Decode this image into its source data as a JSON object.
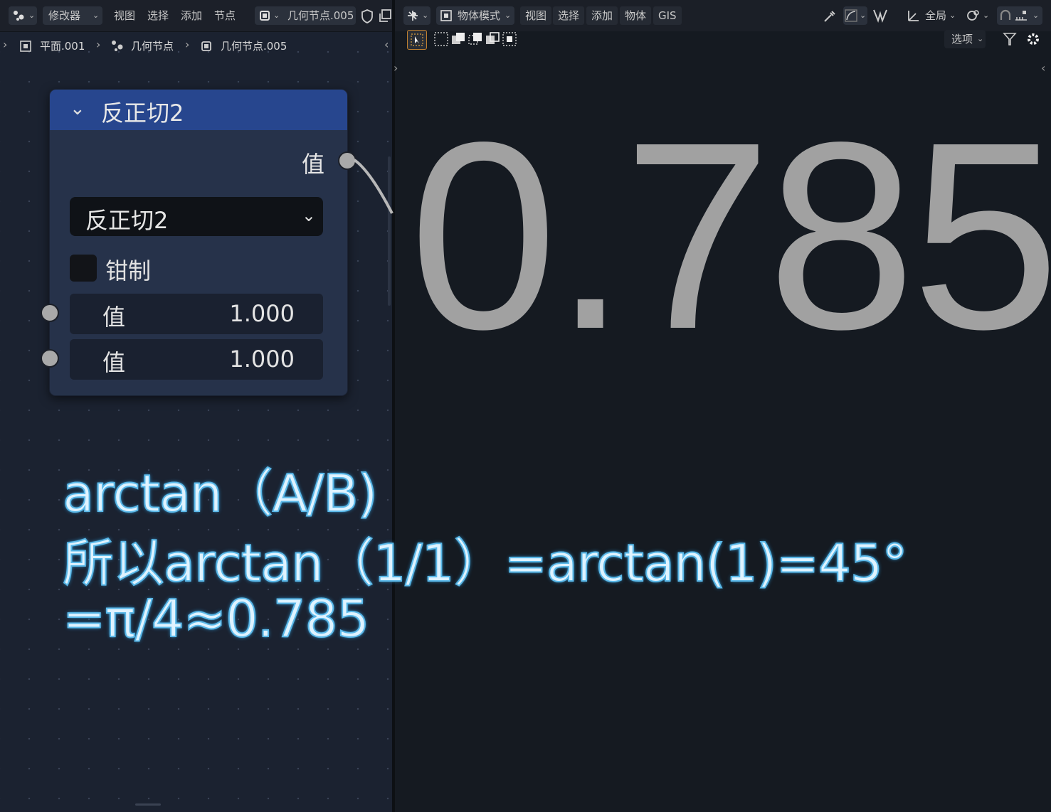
{
  "left_header": {
    "editor_menu": "修改器",
    "menus": [
      "视图",
      "选择",
      "添加",
      "节点"
    ],
    "node_group_name": "几何节点.005"
  },
  "breadcrumb": {
    "items": [
      "平面.001",
      "几何节点",
      "几何节点.005"
    ]
  },
  "node": {
    "title": "反正切2",
    "output_label": "值",
    "operation": "反正切2",
    "clamp_label": "钳制",
    "inputs": [
      {
        "label": "值",
        "value": "1.000"
      },
      {
        "label": "值",
        "value": "1.000"
      }
    ]
  },
  "right_header": {
    "mode": "物体模式",
    "menus": [
      "视图",
      "选择",
      "添加",
      "物体",
      "GIS"
    ],
    "transform_orientation": "全局",
    "options_label": "选项"
  },
  "viewport": {
    "value_text": "0.785"
  },
  "annotation": {
    "line1": "arctan（A/B)",
    "line2": "所以arctan（1/1）=arctan(1)=45°",
    "line3": "=π/4≈0.785"
  }
}
